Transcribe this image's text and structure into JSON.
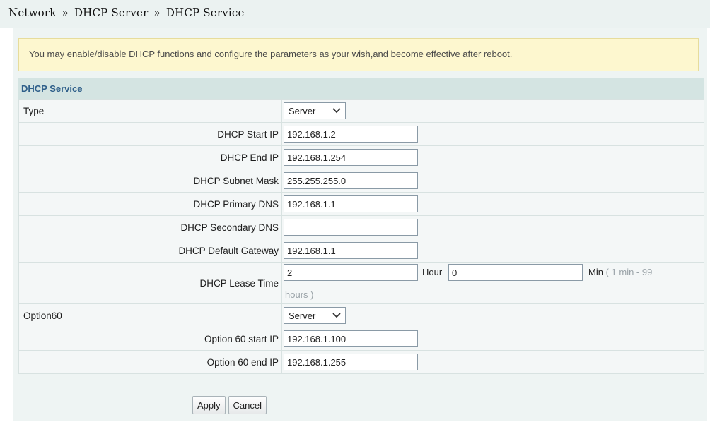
{
  "breadcrumb": {
    "items": [
      "Network",
      "DHCP Server",
      "DHCP Service"
    ],
    "separator": "»"
  },
  "notice": {
    "text": "You may enable/disable DHCP functions and configure the parameters as your wish,and become effective after reboot."
  },
  "section": {
    "title": "DHCP Service"
  },
  "type": {
    "label": "Type",
    "selected": "Server"
  },
  "fields": {
    "start_ip": {
      "label": "DHCP Start IP",
      "value": "192.168.1.2"
    },
    "end_ip": {
      "label": "DHCP End IP",
      "value": "192.168.1.254"
    },
    "subnet_mask": {
      "label": "DHCP Subnet Mask",
      "value": "255.255.255.0"
    },
    "primary_dns": {
      "label": "DHCP Primary DNS",
      "value": "192.168.1.1"
    },
    "secondary_dns": {
      "label": "DHCP Secondary DNS",
      "value": ""
    },
    "default_gateway": {
      "label": "DHCP Default Gateway",
      "value": "192.168.1.1"
    }
  },
  "lease": {
    "label": "DHCP Lease Time",
    "hour_value": "2",
    "hour_label": "Hour",
    "min_value": "0",
    "min_label": "Min",
    "hint_part1": "( 1 min - 99",
    "hint_part2": "hours )"
  },
  "option60": {
    "label": "Option60",
    "selected": "Server",
    "start_ip": {
      "label": "Option 60 start IP",
      "value": "192.168.1.100"
    },
    "end_ip": {
      "label": "Option 60 end IP",
      "value": "192.168.1.255"
    }
  },
  "buttons": {
    "apply": "Apply",
    "cancel": "Cancel"
  },
  "icons": {
    "select_arrow": "chevron-down-icon"
  },
  "colors": {
    "header_bg": "#ebf2f1",
    "notice_bg": "#fdf7cf",
    "section_bg": "#d4e4e2",
    "section_text": "#2f5f8a"
  }
}
